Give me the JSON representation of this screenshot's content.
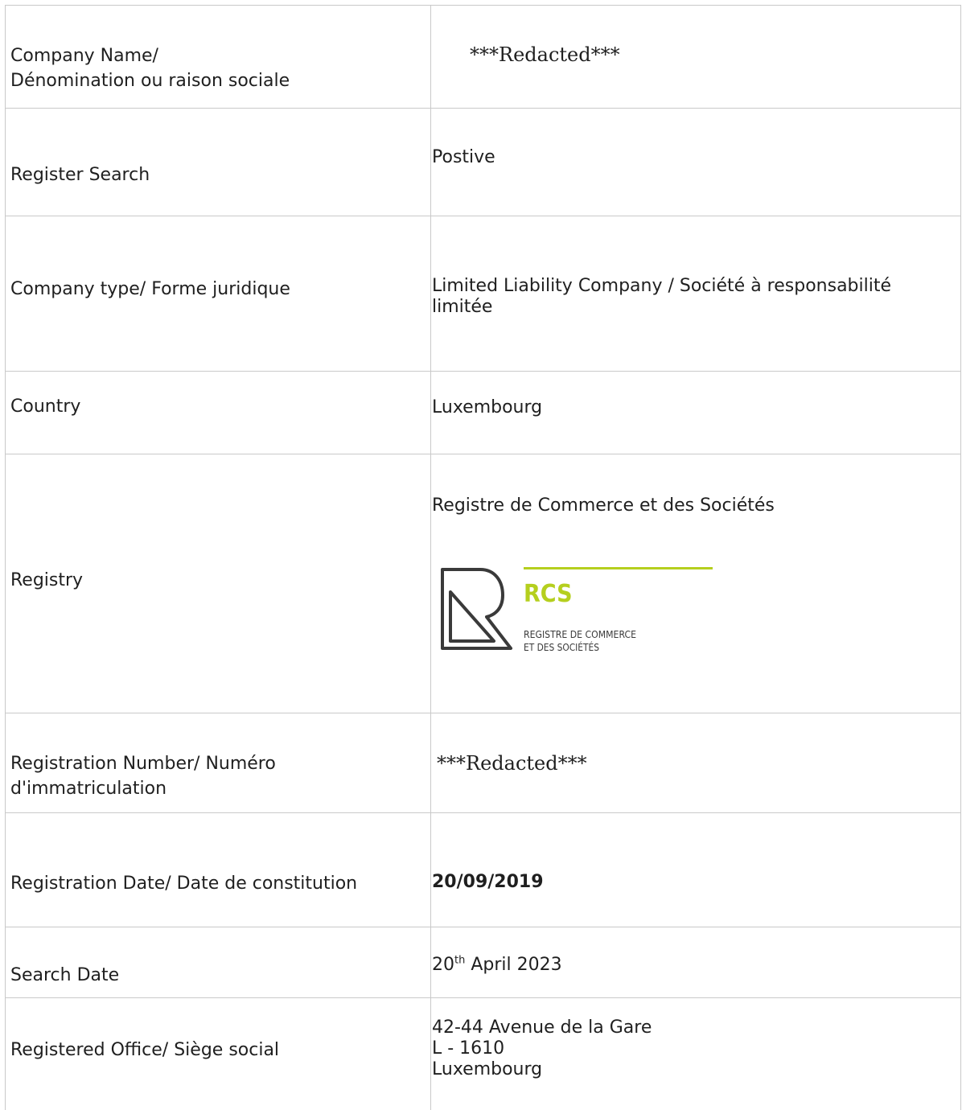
{
  "rows": [
    {
      "label_lines": [
        "Company Name/",
        "Dénomination ou raison sociale"
      ],
      "value": "***Redacted***"
    },
    {
      "label": "Register Search",
      "value": "Postive"
    },
    {
      "label": "Company type/ Forme juridique",
      "value": "Limited Liability Company / Société à responsabilité limitée"
    },
    {
      "label": "Country",
      "value": "Luxembourg"
    },
    {
      "label": "Registry",
      "value": "Registre de Commerce et des Sociétés"
    },
    {
      "label": "Registration Number/ Numéro d'immatriculation",
      "value": "***Redacted***"
    },
    {
      "label": "Registration Date/ Date de constitution",
      "value": "20/09/2019"
    },
    {
      "label": "Search Date",
      "value_day": "20",
      "value_suffix": "th",
      "value_rest": " April 2023"
    },
    {
      "label": "Registered Office/ Siège social",
      "value_lines": [
        "42-44 Avenue de la Gare",
        "L - 1610",
        "Luxembourg"
      ]
    }
  ],
  "logo": {
    "title": "RCS",
    "line1": "REGISTRE DE COMMERCE",
    "line2": "ET DES SOCIÉTÉS",
    "accent_color": "#b5cf1e",
    "mark_color": "#3a3a3a"
  }
}
